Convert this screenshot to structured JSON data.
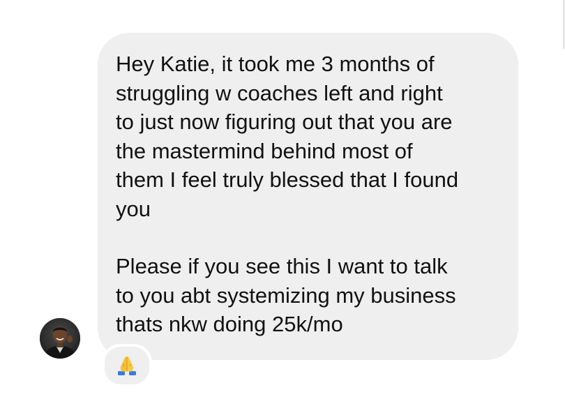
{
  "message": {
    "paragraphs": [
      "Hey Katie, it took me 3 months of\nstruggling w coaches left and right\nto just now figuring out that you are\nthe mastermind behind most of\nthem I feel truly blessed that I found\nyou",
      "Please if you see this I want to talk\nto you abt systemizing my business\nthats nkw doing 25k/mo"
    ],
    "reaction_icon": "folded-hands-icon",
    "sender_avatar": "avatar"
  },
  "colors": {
    "bubble_bg": "#efefef",
    "text": "#111111",
    "page_bg": "#ffffff"
  }
}
